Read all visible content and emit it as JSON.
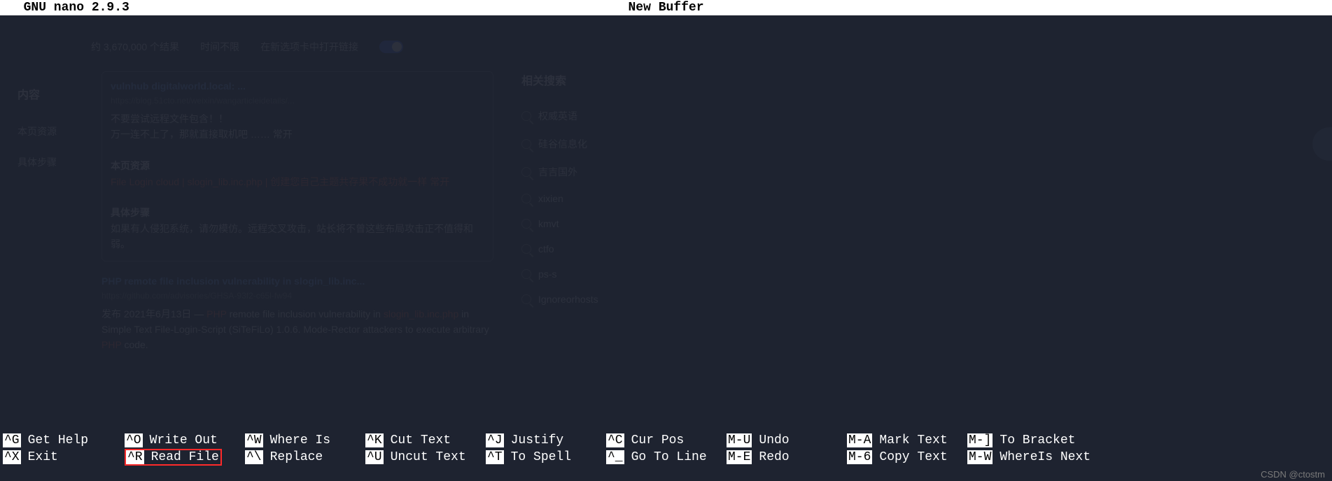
{
  "titlebar": {
    "left": "  GNU nano 2.9.3",
    "center": "New Buffer"
  },
  "background": {
    "toolbar": [
      "约 3,670,000 个结果",
      "时间不限",
      "在新选项卡中打开链接"
    ],
    "sidebar": {
      "title": "内容",
      "items": [
        "本页资源",
        "具体步骤"
      ]
    },
    "card1": {
      "title": "vulnhub digitalworld.local: ...",
      "url": "https://blog.51cto.net/weixin/wangarticleidetails/... ",
      "body": [
        "不要尝试远程文件包含！！",
        "万一连不上了，那就直接取机吧 …… 常开"
      ],
      "sub": "本页资源",
      "hi": "File Login cloud | slogin_lib.inc.php | 创建您自己主题共存果不成功就一样   常开",
      "sub2": "具体步骤",
      "foot": "如果有人侵犯系统，请勿模仿。远程交叉攻击，站长将不曾这些布局攻击正不值得和弱。"
    },
    "card2": {
      "title": "PHP remote file inclusion vulnerability in slogin_lib.inc...",
      "url": "https://github.com/advisories/GHSA-93f2-c65l-fw94 ",
      "line1": "发布 2021年6月13日 — ",
      "hi1": "PHP",
      "mid": " remote file inclusion vulnerability in ",
      "hi2": "slogin_lib.inc.php",
      "tail": " in Simple Text File-Login-Script (SiTeFiLo) 1.0.6. Mode-Rector attackers to execute arbitrary ",
      "hi3": "PHP",
      "end": " code."
    },
    "related": {
      "head": "相关搜索",
      "items": [
        "权威英语",
        "硅谷信息化",
        "吉吉国外",
        "xixien",
        "kmvt",
        "ctfo",
        "ps-s",
        "Ignoreorhosts"
      ]
    }
  },
  "shortcuts": {
    "row1": [
      {
        "key": "^G",
        "label": "Get Help"
      },
      {
        "key": "^O",
        "label": "Write Out"
      },
      {
        "key": "^W",
        "label": "Where Is"
      },
      {
        "key": "^K",
        "label": "Cut Text"
      },
      {
        "key": "^J",
        "label": "Justify"
      },
      {
        "key": "^C",
        "label": "Cur Pos"
      },
      {
        "key": "M-U",
        "label": "Undo"
      },
      {
        "key": "M-A",
        "label": "Mark Text"
      },
      {
        "key": "M-]",
        "label": "To Bracket"
      }
    ],
    "row2": [
      {
        "key": "^X",
        "label": "Exit"
      },
      {
        "key": "^R",
        "label": "Read File"
      },
      {
        "key": "^\\",
        "label": "Replace"
      },
      {
        "key": "^U",
        "label": "Uncut Text"
      },
      {
        "key": "^T",
        "label": "To Spell"
      },
      {
        "key": "^_",
        "label": "Go To Line"
      },
      {
        "key": "M-E",
        "label": "Redo"
      },
      {
        "key": "M-6",
        "label": "Copy Text"
      },
      {
        "key": "M-W",
        "label": "WhereIs Next"
      }
    ]
  },
  "watermark": "CSDN @ctostm"
}
